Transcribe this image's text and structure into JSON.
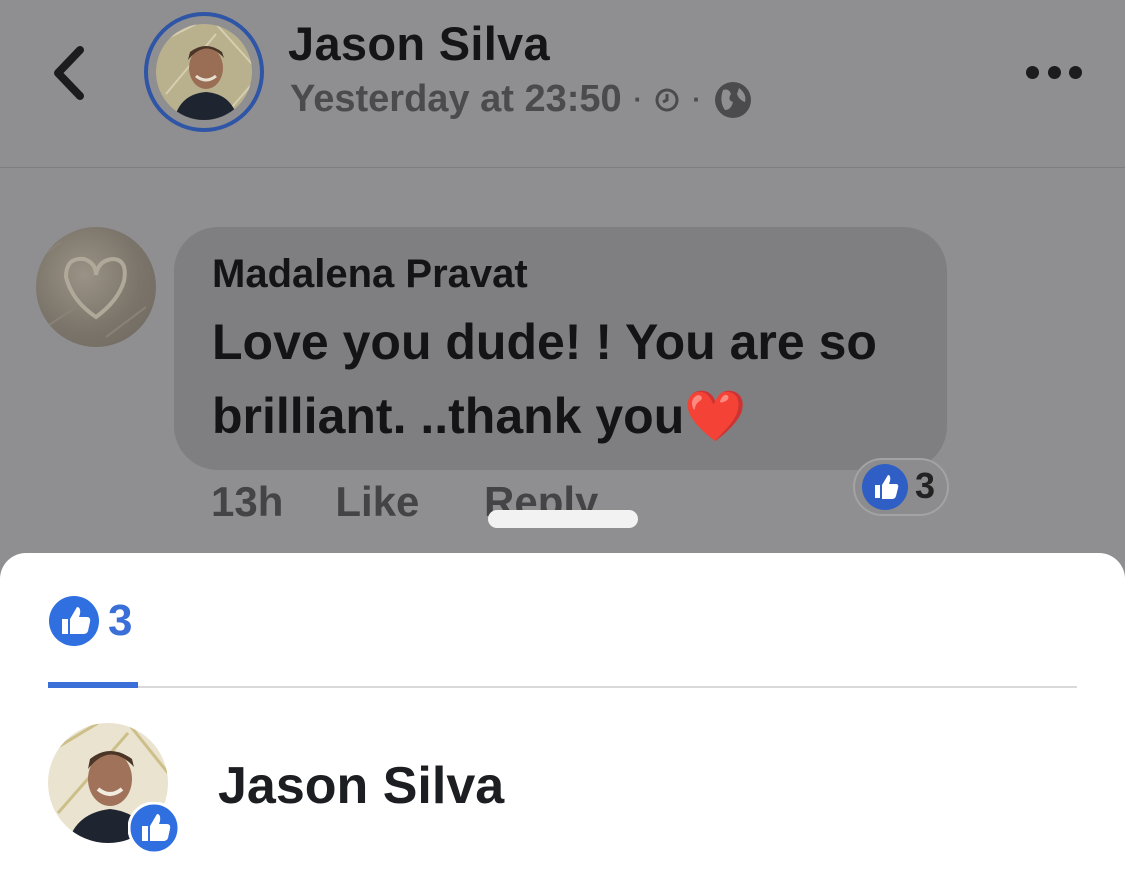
{
  "header": {
    "name": "Jason Silva",
    "timestamp": "Yesterday at 23:50",
    "separator": "·"
  },
  "comment": {
    "author": "Madalena Pravat",
    "text": "Love you dude! ! You are so brilliant. ..thank you",
    "emoji": "❤️",
    "time": "13h",
    "like_label": "Like",
    "reply_label": "Reply",
    "reaction_count": "3"
  },
  "sheet": {
    "tab_count": "3",
    "reactors": [
      {
        "name": "Jason Silva"
      }
    ]
  },
  "colors": {
    "accent": "#3b6fd8",
    "avatar_ring": "#2f55a6",
    "dim_overlay": "#8f8f91"
  },
  "icons": [
    "back-chevron-icon",
    "clock-icon",
    "globe-icon",
    "more-icon",
    "like-icon"
  ]
}
